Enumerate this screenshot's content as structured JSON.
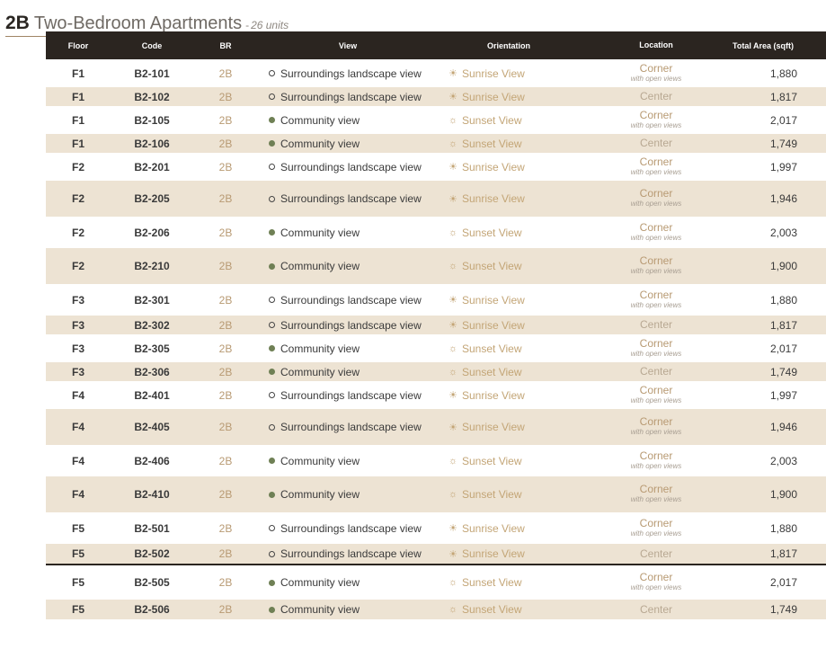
{
  "header": {
    "code": "2B",
    "title": "Two-Bedroom Apartments",
    "separator": "-",
    "units": "26 units"
  },
  "columns": {
    "floor": "Floor",
    "code": "Code",
    "br": "BR",
    "view": "View",
    "orientation": "Orientation",
    "location": "Location",
    "area": "Total Area (sqft)"
  },
  "colors": {
    "header_bg": "#2b2520",
    "stripe": "#ede3d3",
    "accent_tan": "#b89a73",
    "view_green": "#6f8055"
  },
  "labels": {
    "view_landscape": "Surroundings landscape view",
    "view_community": "Community view",
    "orient_sunrise": "Sunrise View",
    "orient_sunset": "Sunset View",
    "loc_corner": "Corner",
    "loc_corner_sub": "with open views",
    "loc_center": "Center"
  },
  "rows": [
    {
      "floor": "F1",
      "code": "B2-101",
      "br": "2B",
      "view": "landscape",
      "orient": "sunrise",
      "loc": "corner",
      "area": "1,880"
    },
    {
      "floor": "F1",
      "code": "B2-102",
      "br": "2B",
      "view": "landscape",
      "orient": "sunrise",
      "loc": "center",
      "area": "1,817"
    },
    {
      "floor": "F1",
      "code": "B2-105",
      "br": "2B",
      "view": "community",
      "orient": "sunset",
      "loc": "corner",
      "area": "2,017"
    },
    {
      "floor": "F1",
      "code": "B2-106",
      "br": "2B",
      "view": "community",
      "orient": "sunset",
      "loc": "center",
      "area": "1,749"
    },
    {
      "floor": "F2",
      "code": "B2-201",
      "br": "2B",
      "view": "landscape",
      "orient": "sunrise",
      "loc": "corner",
      "area": "1,997"
    },
    {
      "floor": "F2",
      "code": "B2-205",
      "br": "2B",
      "view": "landscape",
      "orient": "sunrise",
      "loc": "corner",
      "area": "1,946"
    },
    {
      "floor": "F2",
      "code": "B2-206",
      "br": "2B",
      "view": "community",
      "orient": "sunset",
      "loc": "corner",
      "area": "2,003"
    },
    {
      "floor": "F2",
      "code": "B2-210",
      "br": "2B",
      "view": "community",
      "orient": "sunset",
      "loc": "corner",
      "area": "1,900"
    },
    {
      "floor": "F3",
      "code": "B2-301",
      "br": "2B",
      "view": "landscape",
      "orient": "sunrise",
      "loc": "corner",
      "area": "1,880"
    },
    {
      "floor": "F3",
      "code": "B2-302",
      "br": "2B",
      "view": "landscape",
      "orient": "sunrise",
      "loc": "center",
      "area": "1,817"
    },
    {
      "floor": "F3",
      "code": "B2-305",
      "br": "2B",
      "view": "community",
      "orient": "sunset",
      "loc": "corner",
      "area": "2,017"
    },
    {
      "floor": "F3",
      "code": "B2-306",
      "br": "2B",
      "view": "community",
      "orient": "sunset",
      "loc": "center",
      "area": "1,749"
    },
    {
      "floor": "F4",
      "code": "B2-401",
      "br": "2B",
      "view": "landscape",
      "orient": "sunrise",
      "loc": "corner",
      "area": "1,997"
    },
    {
      "floor": "F4",
      "code": "B2-405",
      "br": "2B",
      "view": "landscape",
      "orient": "sunrise",
      "loc": "corner",
      "area": "1,946"
    },
    {
      "floor": "F4",
      "code": "B2-406",
      "br": "2B",
      "view": "community",
      "orient": "sunset",
      "loc": "corner",
      "area": "2,003"
    },
    {
      "floor": "F4",
      "code": "B2-410",
      "br": "2B",
      "view": "community",
      "orient": "sunset",
      "loc": "corner",
      "area": "1,900"
    },
    {
      "floor": "F5",
      "code": "B2-501",
      "br": "2B",
      "view": "landscape",
      "orient": "sunrise",
      "loc": "corner",
      "area": "1,880"
    },
    {
      "floor": "F5",
      "code": "B2-502",
      "br": "2B",
      "view": "landscape",
      "orient": "sunrise",
      "loc": "center",
      "area": "1,817"
    },
    {
      "floor": "F5",
      "code": "B2-505",
      "br": "2B",
      "view": "community",
      "orient": "sunset",
      "loc": "corner",
      "area": "2,017"
    },
    {
      "floor": "F5",
      "code": "B2-506",
      "br": "2B",
      "view": "community",
      "orient": "sunset",
      "loc": "center",
      "area": "1,749"
    }
  ]
}
